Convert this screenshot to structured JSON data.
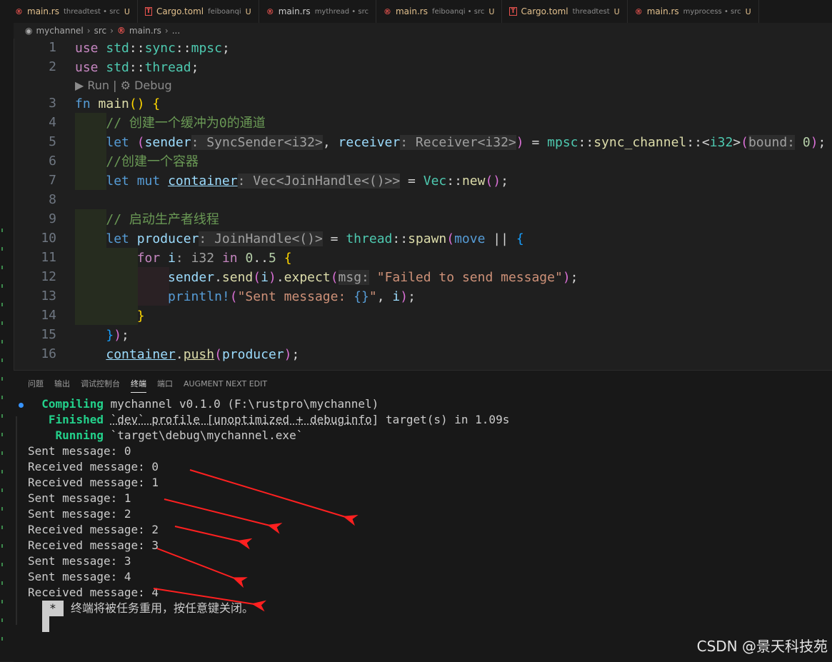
{
  "tabs": [
    {
      "icon": "rust",
      "name": "main.rs",
      "desc": "threadtest • src",
      "mark": "U"
    },
    {
      "icon": "toml",
      "name": "Cargo.toml",
      "desc": "feiboanqi",
      "mark": "U"
    },
    {
      "icon": "rust",
      "name": "main.rs",
      "desc": "mythread • src",
      "mark": ""
    },
    {
      "icon": "rust",
      "name": "main.rs",
      "desc": "feiboanqi • src",
      "mark": "U"
    },
    {
      "icon": "toml",
      "name": "Cargo.toml",
      "desc": "threadtest",
      "mark": "U"
    },
    {
      "icon": "rust",
      "name": "main.rs",
      "desc": "myprocess • src",
      "mark": "U"
    }
  ],
  "breadcrumb": {
    "project": "mychannel",
    "folder": "src",
    "file": "main.rs",
    "more": "..."
  },
  "codelens": {
    "run": "▶ Run",
    "sep": "|",
    "debug": "⚙ Debug"
  },
  "line_numbers": [
    "1",
    "2",
    "3",
    "4",
    "5",
    "6",
    "7",
    "8",
    "9",
    "10",
    "11",
    "12",
    "13",
    "14",
    "15",
    "16"
  ],
  "panel": {
    "tabs": [
      "问题",
      "输出",
      "调试控制台",
      "终端",
      "端口",
      "AUGMENT NEXT EDIT"
    ],
    "active_tab": "终端"
  },
  "terminal": {
    "compiling_label": "Compiling",
    "compiling_text": "mychannel v0.1.0 (F:\\rustpro\\mychannel)",
    "finished_label": "Finished",
    "finished_profile": "`dev` profile [unoptimized + debuginfo]",
    "finished_rest": "target(s) in 1.09s",
    "running_label": "Running",
    "running_text": "`target\\debug\\mychannel.exe`",
    "output": [
      "Sent message: 0",
      "Received message: 0",
      "Received message: 1",
      "Sent message: 1",
      "Sent message: 2",
      "Received message: 2",
      "Received message: 3",
      "Sent message: 3",
      "Sent message: 4",
      "Received message: 4"
    ],
    "reuse_star": "*",
    "reuse_text": "终端将被任务重用，按任意键关闭。"
  },
  "watermark": "CSDN @景天科技苑",
  "colors": {
    "arrow": "#ff2020",
    "compile_green": "#23d18b",
    "rust_icon": "#e8534f"
  }
}
